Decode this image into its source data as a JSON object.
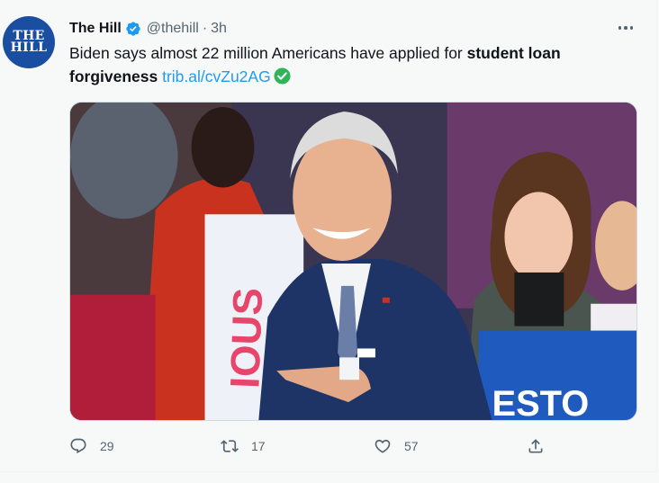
{
  "tweet": {
    "author": {
      "name": "The Hill",
      "handle": "@thehill",
      "avatar_line1": "THE",
      "avatar_line2": "HILL"
    },
    "separator": "·",
    "time": "3h",
    "text_plain": "Biden says almost 22 million Americans have applied for ",
    "text_bold": "student loan forgiveness",
    "link": "trib.al/cvZu2AG",
    "actions": {
      "replies": "29",
      "retweets": "17",
      "likes": "57"
    }
  },
  "icons": {
    "verified": "verified-badge-icon",
    "more": "more-horizontal-icon",
    "check_emoji": "check-mark-emoji-icon",
    "reply": "reply-icon",
    "retweet": "retweet-icon",
    "like": "heart-icon",
    "share": "share-icon"
  },
  "colors": {
    "accent": "#1d9bf0",
    "text": "#0f1419",
    "muted": "#536471",
    "avatar_bg": "#1a4ea1",
    "check_green": "#2fb45a"
  }
}
